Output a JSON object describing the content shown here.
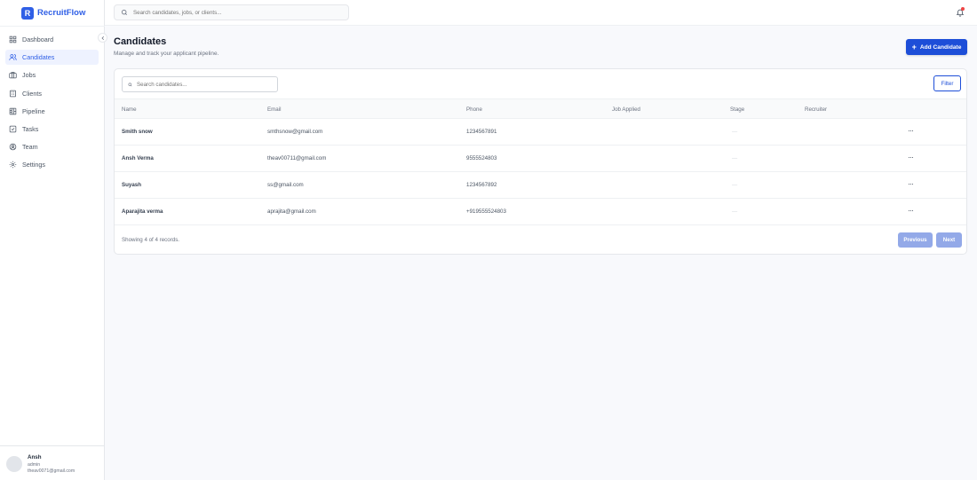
{
  "brand": {
    "logo_letter": "R",
    "name": "RecruitFlow",
    "accent": "#2f5fe6"
  },
  "header": {
    "search_placeholder": "Search candidates, jobs, or clients..."
  },
  "sidebar": {
    "items": [
      {
        "label": "Dashboard",
        "icon": "dashboard-icon"
      },
      {
        "label": "Candidates",
        "icon": "users-icon",
        "active": true
      },
      {
        "label": "Jobs",
        "icon": "briefcase-icon"
      },
      {
        "label": "Clients",
        "icon": "building-icon"
      },
      {
        "label": "Pipeline",
        "icon": "pipeline-icon"
      },
      {
        "label": "Tasks",
        "icon": "checkbox-icon"
      },
      {
        "label": "Team",
        "icon": "user-circle-icon"
      },
      {
        "label": "Settings",
        "icon": "gear-icon"
      }
    ]
  },
  "user": {
    "name": "Ansh",
    "role": "admin",
    "email": "theav0071@gmail.com"
  },
  "page": {
    "title": "Candidates",
    "subtitle": "Manage and track your applicant pipeline.",
    "add_label": "Add Candidate"
  },
  "table": {
    "search_placeholder": "Search candidates...",
    "filter_label": "Filter",
    "columns": [
      "Name",
      "Email",
      "Phone",
      "Job Applied",
      "Stage",
      "Recruiter"
    ],
    "rows": [
      {
        "name": "Smith snow",
        "email": "smthsnow@gmail.com",
        "phone": "1234567891",
        "stage": "—"
      },
      {
        "name": "Ansh Verma",
        "email": "theav00711@gmail.com",
        "phone": "9555524803",
        "stage": "—"
      },
      {
        "name": "Suyash",
        "email": "ss@gmail.com",
        "phone": "1234567892",
        "stage": "—"
      },
      {
        "name": "Aparajita verma",
        "email": "aprajita@gmail.com",
        "phone": "+919555524803",
        "stage": "—"
      }
    ],
    "row_menu": "···",
    "footer_text": "Showing 4 of 4 records.",
    "prev_label": "Previous",
    "next_label": "Next"
  }
}
